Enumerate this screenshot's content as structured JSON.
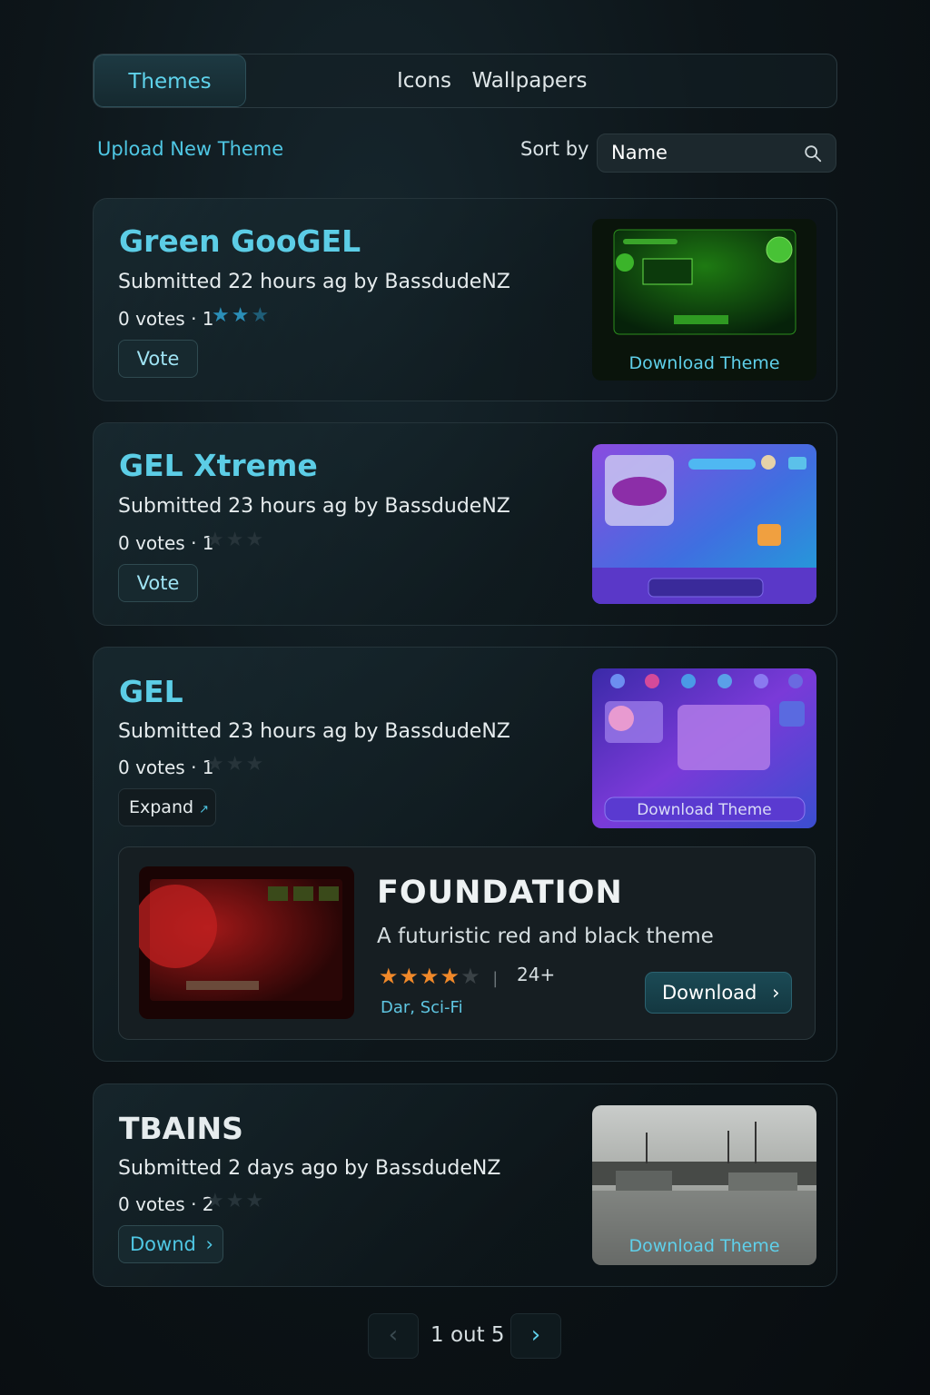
{
  "tabs": [
    {
      "label": "Themes",
      "active": true
    },
    {
      "label": "Icons",
      "active": false
    },
    {
      "label": "Wallpapers",
      "active": false
    }
  ],
  "toolbar": {
    "upload_label": "Upload New Theme",
    "sort_label": "Sort by",
    "sort_value": "Name"
  },
  "themes": [
    {
      "title": "Green GooGEL",
      "submitted_prefix": "Submitted 22 hours ag by BassdudeNZ",
      "votes": "0 votes · 1",
      "rating_filled": 2,
      "button": "Vote",
      "thumb_label": "Download Theme"
    },
    {
      "title": "GEL Xtreme",
      "submitted_prefix": "Submitted 23 hours ag by BassdudeNZ",
      "votes": "0 votes · 1",
      "rating_filled": 0,
      "button": "Vote",
      "thumb_label": ""
    },
    {
      "title": "GEL",
      "submitted_prefix": "Submitted 23 hours ag by BassdudeNZ",
      "votes": "0 votes · 1",
      "rating_filled": 0,
      "button": "Expand",
      "thumb_label": "Download Theme"
    },
    {
      "title": "TBAINS",
      "submitted_prefix": "Submitted 2 days ago  by BassdudeNZ",
      "votes": "0 votes · 2",
      "rating_filled": 0,
      "button": "Downd",
      "thumb_label": "Download Theme"
    }
  ],
  "featured": {
    "title": "FOUNDATION",
    "description": "A futuristic red and black theme",
    "rating_filled": 4,
    "rating_total": 5,
    "age": "24+",
    "tags": "Dar, Sci-Fi",
    "button": "Download"
  },
  "pagination": {
    "text": "1 out 5"
  },
  "colors": {
    "accent": "#5ccde6",
    "star_blue": "#2b8fb8",
    "star_orange": "#f0892a"
  }
}
